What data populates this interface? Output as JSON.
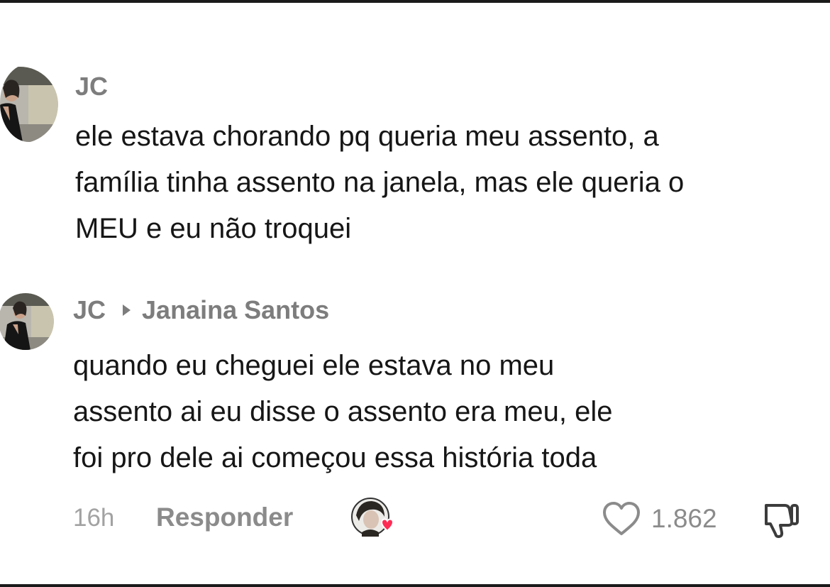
{
  "comments": [
    {
      "username": "JC",
      "text_lines": [
        "ele estava chorando pq queria meu assento, a",
        "família tinha assento na janela, mas ele queria o",
        "MEU e eu não troquei"
      ]
    },
    {
      "username": "JC",
      "reply_to": "Janaina Santos",
      "text_lines": [
        "quando eu cheguei ele estava no meu",
        "assento ai eu disse o assento era meu, ele",
        "foi pro dele ai começou essa história toda"
      ],
      "time": "16h",
      "reply_label": "Responder",
      "like_count": "1.862"
    }
  ],
  "icons": {
    "like": "heart-outline-icon",
    "dislike": "thumbs-down-icon",
    "creator_like": "creator-liked-avatar-icon"
  },
  "colors": {
    "text": "#161616",
    "muted": "#7d7d7d",
    "heart": "#fe2c55"
  }
}
